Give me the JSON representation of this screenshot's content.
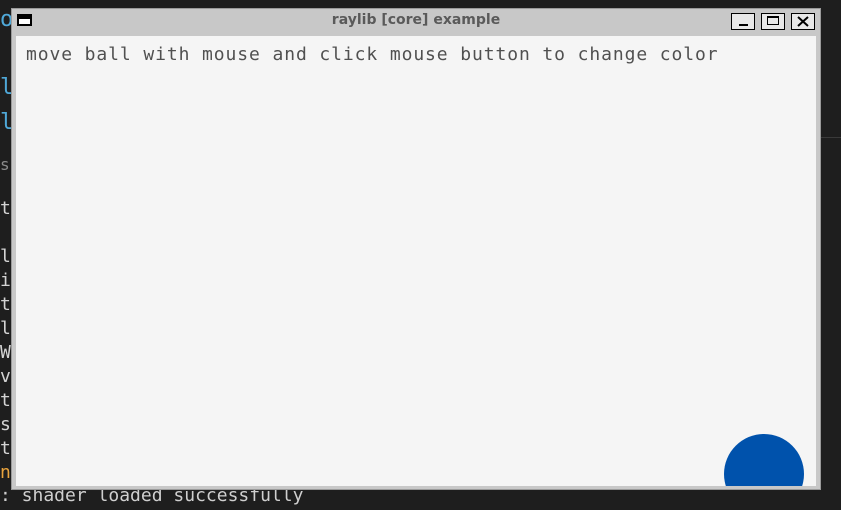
{
  "background": {
    "lines": [
      {
        "text": "oH"
      },
      {
        "text": "lo"
      },
      {
        "text": "lo"
      },
      {
        "text": "sc"
      },
      {
        "text": "to"
      },
      {
        "text": "lo"
      },
      {
        "text": "in"
      },
      {
        "text": "ti"
      },
      {
        "text": "ld"
      },
      {
        "text": "Wi"
      },
      {
        "text": "ve"
      },
      {
        "text": "ti"
      },
      {
        "text": "st"
      },
      {
        "text": "ti"
      },
      {
        "text": "n"
      }
    ],
    "status": ": shader loaded successfully"
  },
  "window": {
    "title": "raylib [core] example",
    "menu_icon": "window-menu-icon",
    "controls": {
      "minimize": "minimize-icon",
      "maximize": "maximize-icon",
      "close": "close-icon"
    }
  },
  "content": {
    "instruction": "move ball with mouse and click mouse button to change color",
    "ball_color": "#0052AC"
  }
}
